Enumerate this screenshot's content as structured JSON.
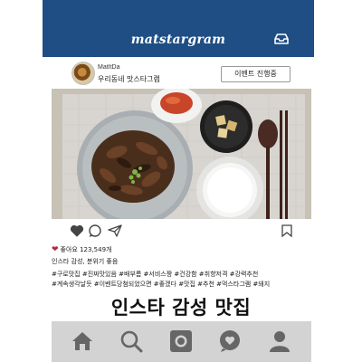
{
  "app": {
    "brand": "matstargram"
  },
  "profile": {
    "name": "MatItDa",
    "subtitle": "우리동네 맛스타그램",
    "event_button": "이벤트 진행중"
  },
  "post": {
    "likes": "좋아요 123,549개",
    "caption": "인스타 감성, 분위기 좋음",
    "tags_line1": "#구로맛집 #진짜맛있음 #배부름 #서비스짱 #건강함 #취향저격 #강력추천",
    "tags_line2": "#계속생각날듯 #이벤트당첨되었으면 #좋겠다 #맛집 #추천 #먹스타그램 #돼지"
  },
  "headline": "인스타 감성 맛집",
  "icons": {
    "inbox": "inbox-icon",
    "like": "heart-icon",
    "comment": "comment-icon",
    "share": "send-icon",
    "bookmark": "bookmark-icon",
    "nav": [
      "home-icon",
      "search-icon",
      "camera-icon",
      "activity-heart-icon",
      "profile-icon"
    ]
  },
  "colors": {
    "header_bg": "#1e4e84",
    "nav_bg": "#d3d3d3",
    "like_heart": "#b5283c"
  }
}
